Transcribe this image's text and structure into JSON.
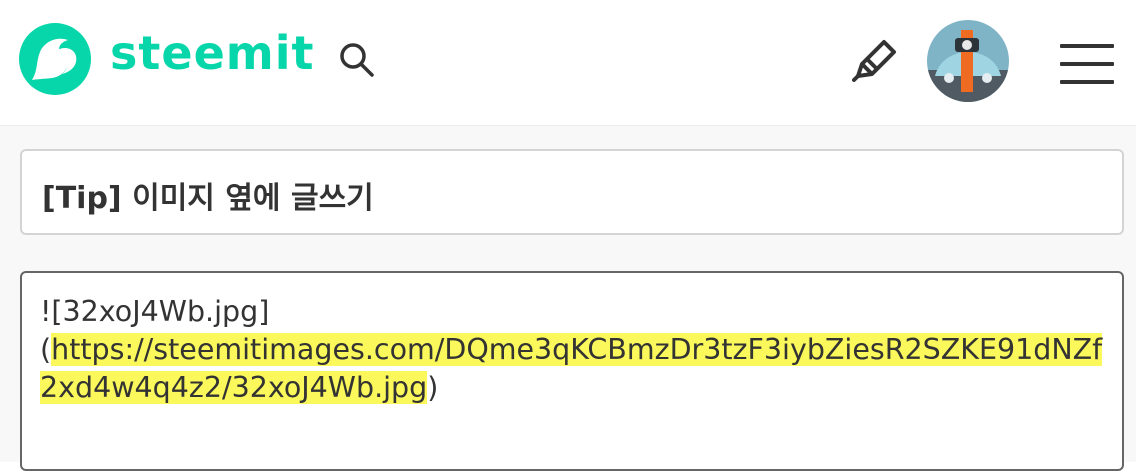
{
  "header": {
    "brand": "steemit",
    "logo_icon": "steemit-logo-icon",
    "search_icon": "search-icon",
    "write_icon": "pencil-icon",
    "avatar": "user-avatar",
    "menu_icon": "hamburger-menu-icon",
    "brand_color": "#06d6a9"
  },
  "editor": {
    "title_value": "[Tip] 이미지 옆에 글쓰기",
    "body": {
      "line_prefix": "![32xoJ4Wb.jpg]\n(",
      "highlighted_url": "https://steemitimages.com/DQme3qKCBmzDr3tzF3iybZiesR2SZKE91dNZf2xd4w4q4z2/32xoJ4Wb.jpg",
      "line_suffix": ")",
      "highlight_color": "#faf85a"
    }
  }
}
